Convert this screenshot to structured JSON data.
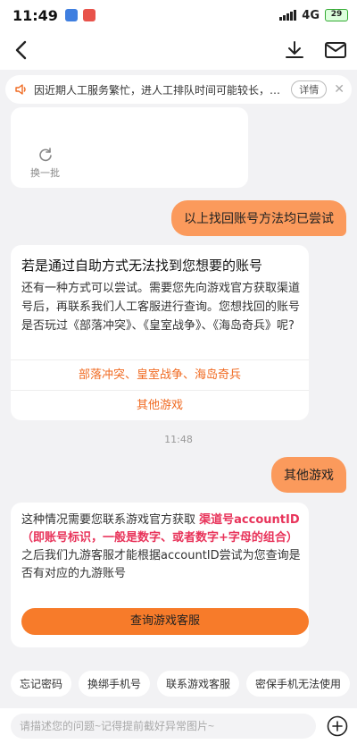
{
  "status": {
    "time": "11:49",
    "network": "4G",
    "battery": "29"
  },
  "notice": {
    "text": "因近期人工服务繁忙，进人工排队时间可能较长，建...",
    "detail_label": "详情"
  },
  "refresh_card": {
    "label": "换一批"
  },
  "outgoing_1": "以上找回账号方法均已尝试",
  "card2": {
    "title": "若是通过自助方式无法找到您想要的账号",
    "body": "还有一种方式可以尝试。需要您先向游戏官方获取渠道号后，再联系我们人工客服进行查询。您想找回的账号是否玩过《部落冲突》、《皇室战争》、《海岛奇兵》呢?",
    "options": [
      "部落冲突、皇室战争、海岛奇兵",
      "其他游戏"
    ]
  },
  "timestamp": "11:48",
  "outgoing_2": "其他游戏",
  "card3": {
    "text_before": "这种情况需要您联系游戏官方获取 ",
    "highlight": "渠道号accountID（即账号标识，一般是数字、或者数字+字母的组合）",
    "text_after": "之后我们九游客服才能根据accountID尝试为您查询是否有对应的九游账号",
    "button_label": "查询游戏客服"
  },
  "chips": [
    "忘记密码",
    "换绑手机号",
    "联系游戏客服",
    "密保手机无法使用"
  ],
  "input": {
    "placeholder": "请描述您的问题~记得提前截好异常图片~"
  }
}
